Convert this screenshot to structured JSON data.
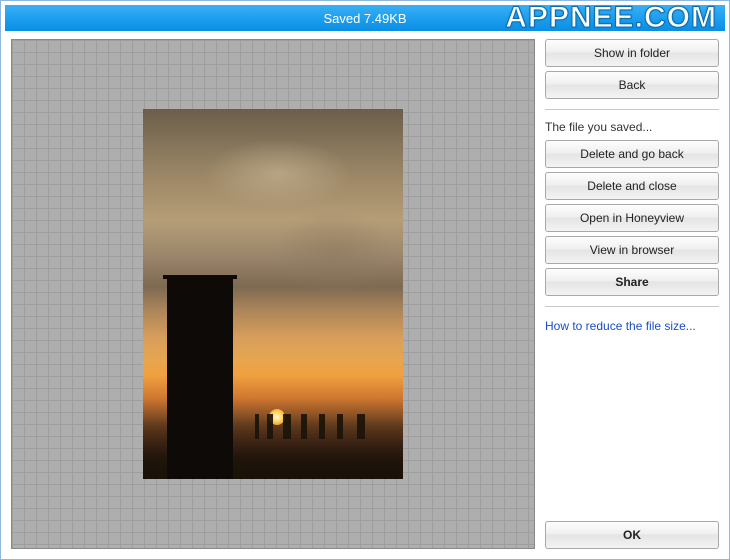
{
  "titlebar": {
    "text": "Saved 7.49KB"
  },
  "watermark": "APPNEE.COM",
  "buttons": {
    "show_in_folder": "Show in folder",
    "back": "Back",
    "delete_go_back": "Delete and go back",
    "delete_close": "Delete and close",
    "open_honeyview": "Open in Honeyview",
    "view_browser": "View in browser",
    "share": "Share",
    "ok": "OK"
  },
  "labels": {
    "file_saved": "The file you saved...",
    "reduce_size_link": "How to reduce the file size..."
  }
}
